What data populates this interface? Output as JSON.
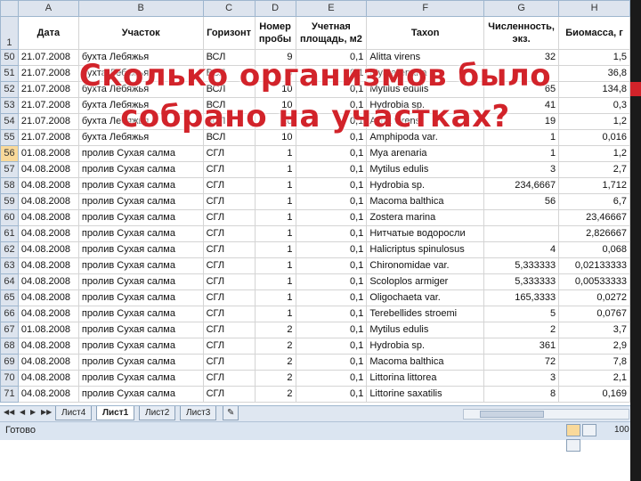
{
  "columns": [
    "A",
    "B",
    "C",
    "D",
    "E",
    "F",
    "G",
    "H"
  ],
  "header_row_number": "1",
  "headers": [
    "Дата",
    "Участок",
    "Горизонт",
    "Номер пробы",
    "Учетная площадь, м2",
    "Taxon",
    "Численность, экз.",
    "Биомасса, г"
  ],
  "rows": [
    {
      "n": "50",
      "date": "21.07.2008",
      "site": "бухта Лебяжья",
      "hor": "ВСЛ",
      "probe": "9",
      "area": "0,1",
      "taxon": "Alitta virens",
      "count": "32",
      "bio": "1,5"
    },
    {
      "n": "51",
      "date": "21.07.2008",
      "site": "бухта Лебяжья",
      "hor": "ВСЛ",
      "probe": "9",
      "area": "0,1",
      "taxon": "Mya arenaria",
      "count": "",
      "bio": "36,8"
    },
    {
      "n": "52",
      "date": "21.07.2008",
      "site": "бухта Лебяжья",
      "hor": "ВСЛ",
      "probe": "10",
      "area": "0,1",
      "taxon": "Mytilus edulis",
      "count": "65",
      "bio": "134,8"
    },
    {
      "n": "53",
      "date": "21.07.2008",
      "site": "бухта Лебяжья",
      "hor": "ВСЛ",
      "probe": "10",
      "area": "0,1",
      "taxon": "Hydrobia sp.",
      "count": "41",
      "bio": "0,3"
    },
    {
      "n": "54",
      "date": "21.07.2008",
      "site": "бухта Лебяжья",
      "hor": "ВСЛ",
      "probe": "10",
      "area": "0,1",
      "taxon": "Alitta virens",
      "count": "19",
      "bio": "1,2"
    },
    {
      "n": "55",
      "date": "21.07.2008",
      "site": "бухта Лебяжья",
      "hor": "ВСЛ",
      "probe": "10",
      "area": "0,1",
      "taxon": "Amphipoda var.",
      "count": "1",
      "bio": "0,016"
    },
    {
      "n": "56",
      "date": "01.08.2008",
      "site": "пролив Сухая салма",
      "hor": "СГЛ",
      "probe": "1",
      "area": "0,1",
      "taxon": "Mya arenaria",
      "count": "1",
      "bio": "1,2"
    },
    {
      "n": "57",
      "date": "04.08.2008",
      "site": "пролив Сухая салма",
      "hor": "СГЛ",
      "probe": "1",
      "area": "0,1",
      "taxon": "Mytilus edulis",
      "count": "3",
      "bio": "2,7"
    },
    {
      "n": "58",
      "date": "04.08.2008",
      "site": "пролив Сухая салма",
      "hor": "СГЛ",
      "probe": "1",
      "area": "0,1",
      "taxon": "Hydrobia sp.",
      "count": "234,6667",
      "bio": "1,712"
    },
    {
      "n": "59",
      "date": "04.08.2008",
      "site": "пролив Сухая салма",
      "hor": "СГЛ",
      "probe": "1",
      "area": "0,1",
      "taxon": "Macoma balthica",
      "count": "56",
      "bio": "6,7"
    },
    {
      "n": "60",
      "date": "04.08.2008",
      "site": "пролив Сухая салма",
      "hor": "СГЛ",
      "probe": "1",
      "area": "0,1",
      "taxon": "Zostera marina",
      "count": "",
      "bio": "23,46667"
    },
    {
      "n": "61",
      "date": "04.08.2008",
      "site": "пролив Сухая салма",
      "hor": "СГЛ",
      "probe": "1",
      "area": "0,1",
      "taxon": "Нитчатые водоросли",
      "count": "",
      "bio": "2,826667"
    },
    {
      "n": "62",
      "date": "04.08.2008",
      "site": "пролив Сухая салма",
      "hor": "СГЛ",
      "probe": "1",
      "area": "0,1",
      "taxon": "Halicriptus spinulosus",
      "count": "4",
      "bio": "0,068"
    },
    {
      "n": "63",
      "date": "04.08.2008",
      "site": "пролив Сухая салма",
      "hor": "СГЛ",
      "probe": "1",
      "area": "0,1",
      "taxon": "Chironomidae var.",
      "count": "5,333333",
      "bio": "0,02133333"
    },
    {
      "n": "64",
      "date": "04.08.2008",
      "site": "пролив Сухая салма",
      "hor": "СГЛ",
      "probe": "1",
      "area": "0,1",
      "taxon": "Scoloplos armiger",
      "count": "5,333333",
      "bio": "0,00533333"
    },
    {
      "n": "65",
      "date": "04.08.2008",
      "site": "пролив Сухая салма",
      "hor": "СГЛ",
      "probe": "1",
      "area": "0,1",
      "taxon": "Oligochaeta var.",
      "count": "165,3333",
      "bio": "0,0272"
    },
    {
      "n": "66",
      "date": "04.08.2008",
      "site": "пролив Сухая салма",
      "hor": "СГЛ",
      "probe": "1",
      "area": "0,1",
      "taxon": "Terebellides stroemi",
      "count": "5",
      "bio": "0,0767"
    },
    {
      "n": "67",
      "date": "01.08.2008",
      "site": "пролив Сухая салма",
      "hor": "СГЛ",
      "probe": "2",
      "area": "0,1",
      "taxon": "Mytilus edulis",
      "count": "2",
      "bio": "3,7"
    },
    {
      "n": "68",
      "date": "04.08.2008",
      "site": "пролив Сухая салма",
      "hor": "СГЛ",
      "probe": "2",
      "area": "0,1",
      "taxon": "Hydrobia sp.",
      "count": "361",
      "bio": "2,9"
    },
    {
      "n": "69",
      "date": "04.08.2008",
      "site": "пролив Сухая салма",
      "hor": "СГЛ",
      "probe": "2",
      "area": "0,1",
      "taxon": "Macoma balthica",
      "count": "72",
      "bio": "7,8"
    },
    {
      "n": "70",
      "date": "04.08.2008",
      "site": "пролив Сухая салма",
      "hor": "СГЛ",
      "probe": "2",
      "area": "0,1",
      "taxon": "Littorina littorea",
      "count": "3",
      "bio": "2,1"
    },
    {
      "n": "71",
      "date": "04.08.2008",
      "site": "пролив Сухая салма",
      "hor": "СГЛ",
      "probe": "2",
      "area": "0,1",
      "taxon": "Littorine saxatilis",
      "count": "8",
      "bio": "0,169"
    }
  ],
  "active_row": "56",
  "overlay": {
    "line1": "Сколько организмов было",
    "line2": "собрано на участках?"
  },
  "sheet_tabs": [
    "Лист4",
    "Лист1",
    "Лист2",
    "Лист3"
  ],
  "active_tab": "Лист1",
  "status": {
    "ready": "Готово",
    "zoom": "100"
  },
  "colors": {
    "accent": "#d2232a",
    "header_bg": "#dde4ee",
    "active_row_bg": "#f9d99a"
  }
}
